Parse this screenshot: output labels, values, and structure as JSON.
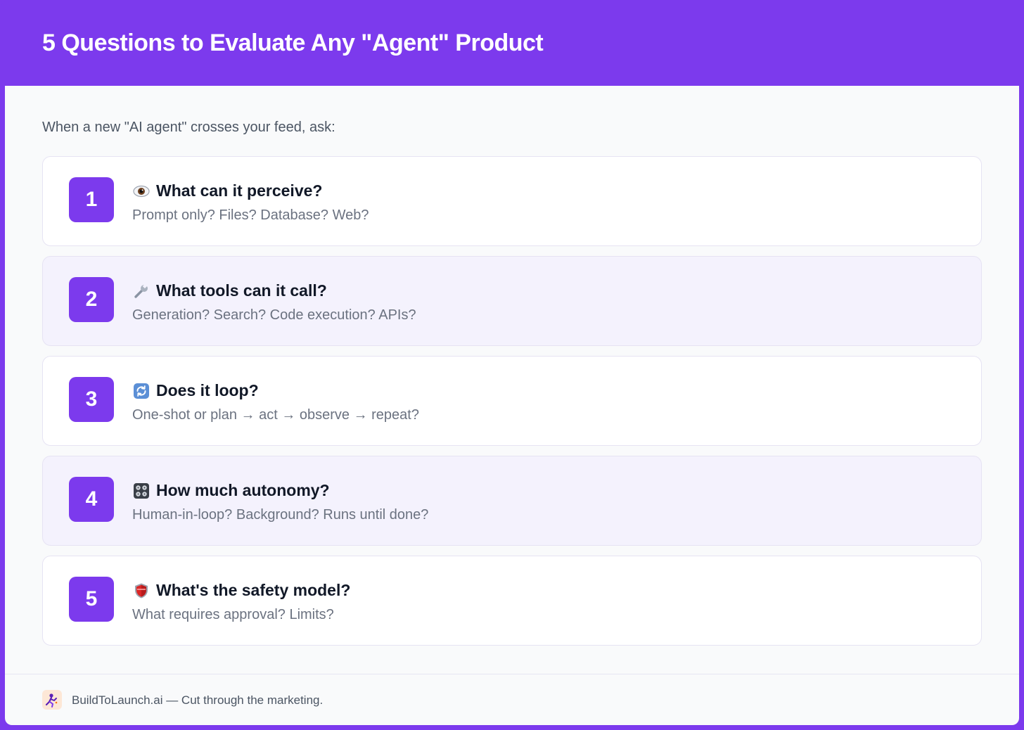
{
  "header": {
    "title": "5 Questions to Evaluate Any \"Agent\" Product"
  },
  "intro": "When a new \"AI agent\" crosses your feed, ask:",
  "questions": [
    {
      "number": "1",
      "icon": "eye-icon",
      "title": "What can it perceive?",
      "description": "Prompt only? Files? Database? Web?"
    },
    {
      "number": "2",
      "icon": "wrench-icon",
      "title": "What tools can it call?",
      "description": "Generation? Search? Code execution? APIs?"
    },
    {
      "number": "3",
      "icon": "loop-arrows-icon",
      "title": "Does it loop?",
      "description": "One-shot or plan → act → observe → repeat?"
    },
    {
      "number": "4",
      "icon": "control-knobs-icon",
      "title": "How much autonomy?",
      "description": "Human-in-loop? Background? Runs until done?"
    },
    {
      "number": "5",
      "icon": "shield-icon",
      "title": "What's the safety model?",
      "description": "What requires approval? Limits?"
    }
  ],
  "footer": {
    "logo_icon": "buildtolaunch-logo-icon",
    "text": "BuildToLaunch.ai — Cut through the marketing."
  },
  "colors": {
    "accent": "#7c3aed",
    "title_text": "#111827",
    "muted_text": "#6b7280",
    "alt_card": "#f4f2fd"
  }
}
